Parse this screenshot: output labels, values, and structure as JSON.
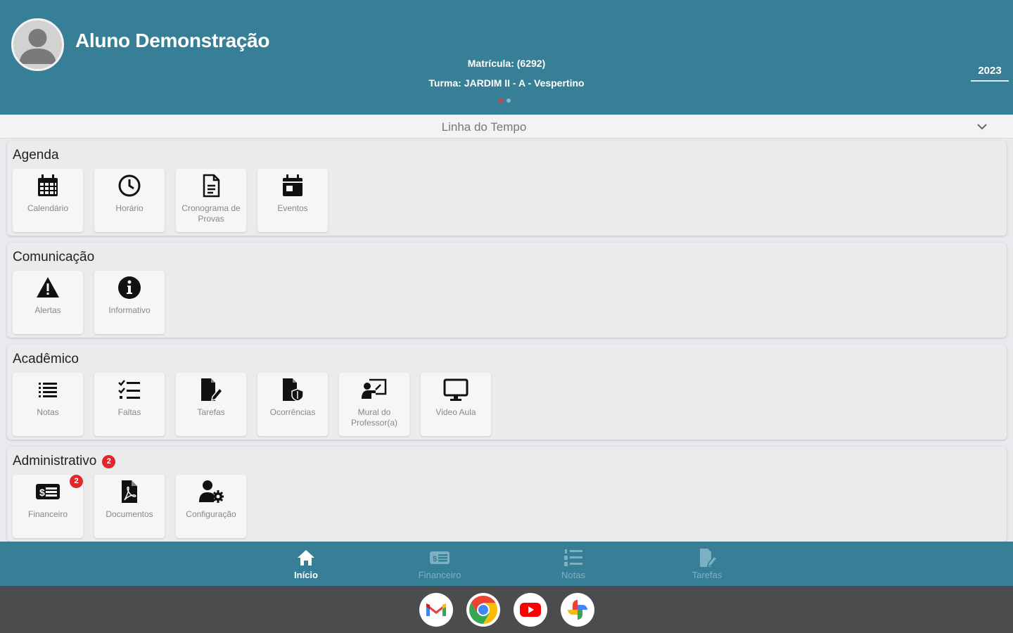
{
  "header": {
    "student_name": "Aluno Demonstração",
    "matricula": "Matrícula: (6292)",
    "turma": "Turma: JARDIM II - A - Vespertino",
    "year": "2023",
    "colors": {
      "background": "#367f97",
      "active_dot": "#e53935"
    }
  },
  "timeline": {
    "label": "Linha do Tempo",
    "icon": "chevron-down-icon"
  },
  "sections": [
    {
      "title": "Agenda",
      "tiles": [
        {
          "label": "Calendário",
          "icon": "calendar-icon"
        },
        {
          "label": "Horário",
          "icon": "clock-icon"
        },
        {
          "label": "Cronograma de Provas",
          "icon": "document-icon"
        },
        {
          "label": "Eventos",
          "icon": "event-calendar-icon"
        }
      ]
    },
    {
      "title": "Comunicação",
      "tiles": [
        {
          "label": "Alertas",
          "icon": "warning-icon"
        },
        {
          "label": "Informativo",
          "icon": "info-icon"
        }
      ]
    },
    {
      "title": "Acadêmico",
      "tiles": [
        {
          "label": "Notas",
          "icon": "list-icon"
        },
        {
          "label": "Faltas",
          "icon": "checklist-icon"
        },
        {
          "label": "Tarefas",
          "icon": "file-edit-icon"
        },
        {
          "label": "Ocorrências",
          "icon": "file-shield-icon"
        },
        {
          "label": "Mural do Professor(a)",
          "icon": "chalkboard-teacher-icon"
        },
        {
          "label": "Video Aula",
          "icon": "monitor-icon"
        }
      ]
    },
    {
      "title": "Administrativo",
      "badge": "2",
      "tiles": [
        {
          "label": "Financeiro",
          "icon": "money-bill-icon",
          "badge": "2"
        },
        {
          "label": "Documentos",
          "icon": "pdf-file-icon"
        },
        {
          "label": "Configuração",
          "icon": "user-gear-icon"
        }
      ]
    }
  ],
  "bottom_nav": [
    {
      "label": "Início",
      "icon": "home-icon",
      "active": true
    },
    {
      "label": "Financeiro",
      "icon": "money-bill-icon",
      "active": false
    },
    {
      "label": "Notas",
      "icon": "numbered-list-icon",
      "active": false
    },
    {
      "label": "Tarefas",
      "icon": "file-edit-icon",
      "active": false
    }
  ],
  "dock_apps": [
    "gmail-icon",
    "chrome-icon",
    "youtube-icon",
    "photos-icon"
  ]
}
